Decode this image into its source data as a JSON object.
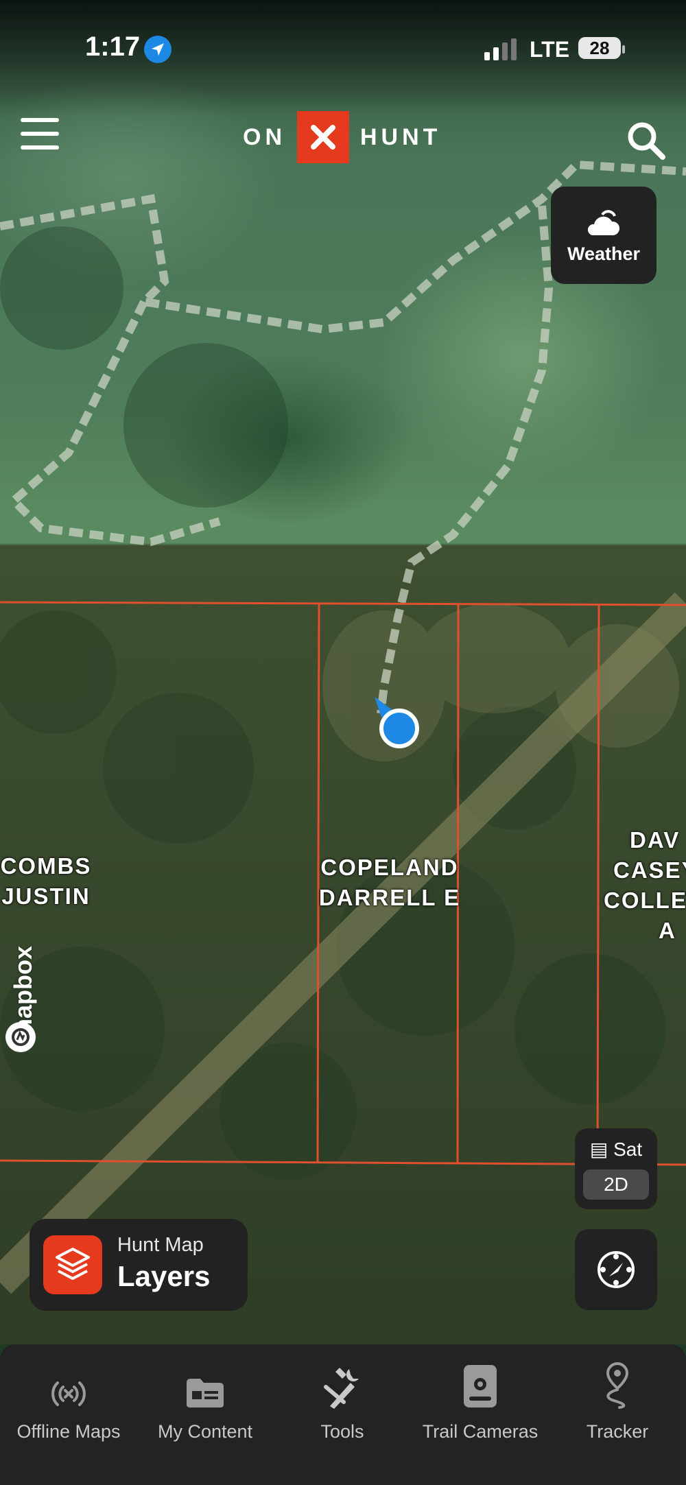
{
  "status_bar": {
    "time": "1:17",
    "network": "LTE",
    "battery": "28"
  },
  "header": {
    "logo_left": "ON",
    "logo_right": "HUNT"
  },
  "weather_button": {
    "label": "Weather"
  },
  "map": {
    "parcels": [
      {
        "owner_line1": "COMBS",
        "owner_line2": "JUSTIN"
      },
      {
        "owner_line1": "COPELAND",
        "owner_line2": "DARRELL E"
      },
      {
        "owner_line1": "DAV",
        "owner_line2": "CASEY",
        "owner_line3": "COLLE",
        "owner_line4": "A"
      }
    ],
    "attribution": "mapbox",
    "boundary_color": "#e0502e",
    "location_dot_color": "#1e88e5"
  },
  "basemap_control": {
    "label": "Sat",
    "view_mode": "2D"
  },
  "layers_button": {
    "subtitle": "Hunt Map",
    "title": "Layers"
  },
  "tabs": [
    {
      "label": "Offline Maps",
      "icon": "offline-signal-icon"
    },
    {
      "label": "My Content",
      "icon": "folder-card-icon"
    },
    {
      "label": "Tools",
      "icon": "tools-icon"
    },
    {
      "label": "Trail Cameras",
      "icon": "trail-camera-icon"
    },
    {
      "label": "Tracker",
      "icon": "tracker-pin-icon"
    }
  ]
}
